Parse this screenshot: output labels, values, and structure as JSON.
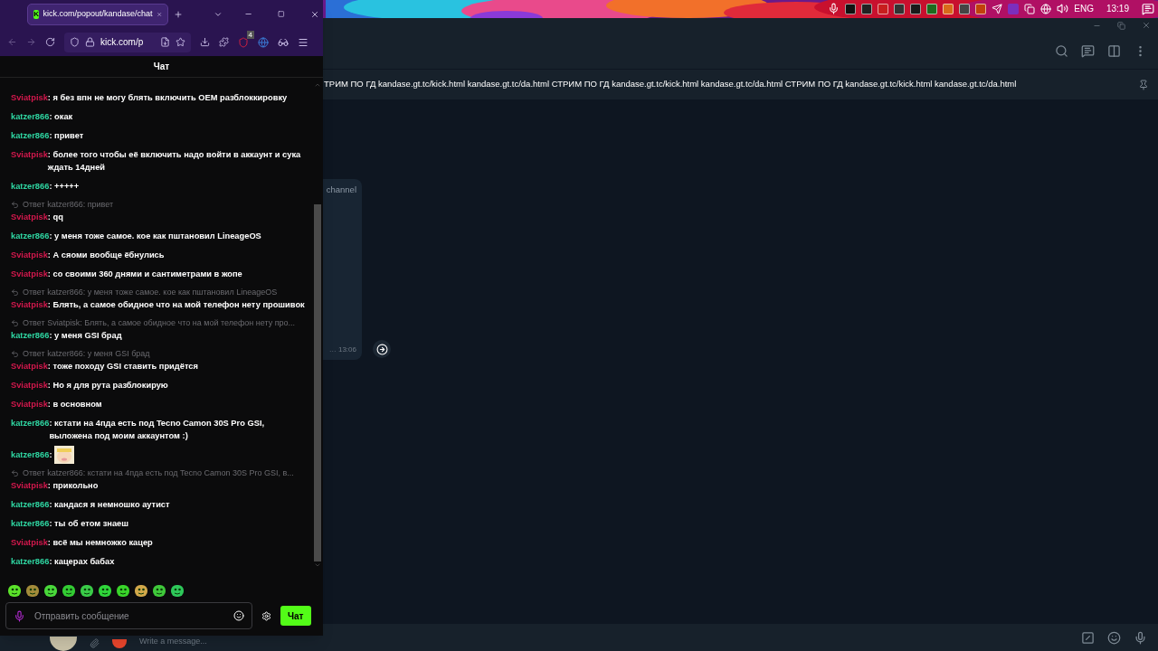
{
  "tray": {
    "language": "ENG",
    "time": "13:19"
  },
  "browser": {
    "tab": {
      "favicon_letter": "K",
      "title": "kick.com/popout/kandase/chat"
    },
    "url": "kick.com/p",
    "extension_badge": "4"
  },
  "chat": {
    "header": "Чат",
    "messages": [
      {
        "user": "Sviatpisk",
        "color": "#d3184d",
        "text": ": я без впн не могу блять включить OEM разблоккировку"
      },
      {
        "user": "katzer866",
        "color": "#2fd6a2",
        "text": ": окак"
      },
      {
        "user": "katzer866",
        "color": "#2fd6a2",
        "text": ": привет"
      },
      {
        "user": "Sviatpisk",
        "color": "#d3184d",
        "text": ": более того чтобы её включить надо войти в аккаунт и сука ждать 14дней"
      },
      {
        "user": "katzer866",
        "color": "#2fd6a2",
        "text": ": +++++"
      },
      {
        "user": "Sviatpisk",
        "color": "#d3184d",
        "text": ": qq",
        "reply": "Ответ katzer866: привет"
      },
      {
        "user": "katzer866",
        "color": "#2fd6a2",
        "text": ": у меня тоже самое. кое как пштановил LineageOS"
      },
      {
        "user": "Sviatpisk",
        "color": "#d3184d",
        "text": ": А сяоми вообще ёбнулись"
      },
      {
        "user": "Sviatpisk",
        "color": "#d3184d",
        "text": ": со своими 360 днями и сантиметрами в жопе"
      },
      {
        "user": "Sviatpisk",
        "color": "#d3184d",
        "text": ": Блять, а самое обидное что на мой телефон нету прошивок",
        "reply": "Ответ katzer866: у меня тоже самое. кое как пштановил LineageOS"
      },
      {
        "user": "katzer866",
        "color": "#2fd6a2",
        "text": ": у меня GSI брад",
        "reply": "Ответ Sviatpisk: Блять, а самое обидное что на мой телефон нету про..."
      },
      {
        "user": "Sviatpisk",
        "color": "#d3184d",
        "text": ": тоже походу GSI ставить придётся",
        "reply": "Ответ katzer866: у меня GSI брад"
      },
      {
        "user": "Sviatpisk",
        "color": "#d3184d",
        "text": ": Но я для рута разблокирую"
      },
      {
        "user": "Sviatpisk",
        "color": "#d3184d",
        "text": ": в основном"
      },
      {
        "user": "katzer866",
        "color": "#2fd6a2",
        "text": ": кстати на 4пда есть под Tecno Camon 30S Pro GSI, выложена под моим аккаунтом :)"
      },
      {
        "user": "katzer866",
        "color": "#2fd6a2",
        "kind": "emote",
        "text": ":"
      },
      {
        "user": "Sviatpisk",
        "color": "#d3184d",
        "text": ": прикольно",
        "reply": "Ответ katzer866: кстати на 4пда есть под Tecno Camon 30S Pro GSI, в..."
      },
      {
        "user": "katzer866",
        "color": "#2fd6a2",
        "text": ": кандася я немношко аутист"
      },
      {
        "user": "katzer866",
        "color": "#2fd6a2",
        "text": ": ты об етом знаеш"
      },
      {
        "user": "Sviatpisk",
        "color": "#d3184d",
        "text": ": всё мы немножко кацер"
      },
      {
        "user": "katzer866",
        "color": "#2fd6a2",
        "text": ": кацерах бабах"
      }
    ],
    "input_placeholder": "Отправить сообщение",
    "send_button": "Чат"
  },
  "telegram": {
    "pinned": "ТРИМ ПО ГД kandase.gt.tc/kick.html kandase.gt.tc/da.html  СТРИМ ПО ГД kandase.gt.tc/kick.html kandase.gt.tc/da.html  СТРИМ ПО ГД kandase.gt.tc/kick.html kandase.gt.tc/da.html",
    "bubble_text": "channel",
    "bubble_time": "… 13:06",
    "input_placeholder": "Write a message..."
  }
}
